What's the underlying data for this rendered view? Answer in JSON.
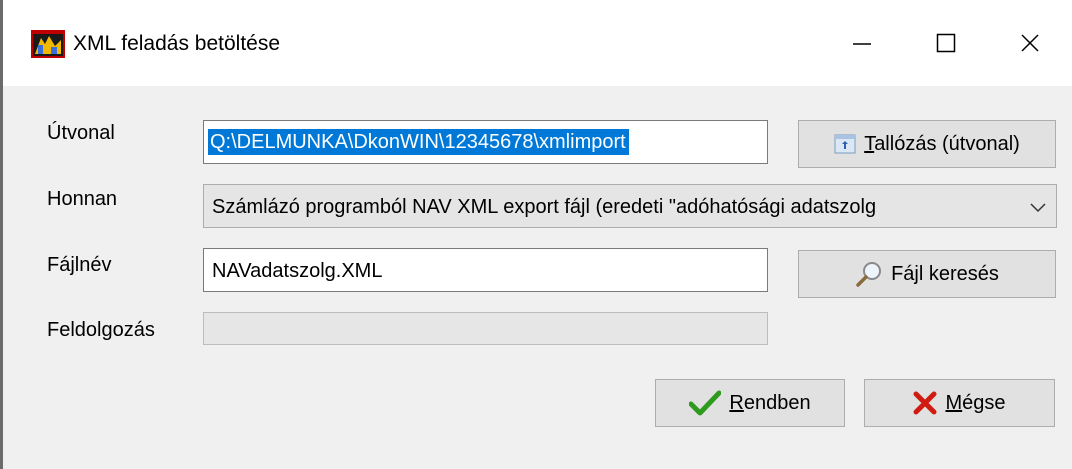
{
  "window": {
    "title": "XML feladás betöltése"
  },
  "form": {
    "path_label": "Útvonal",
    "path_value": "Q:\\DELMUNKA\\DkonWIN\\12345678\\xmlimport",
    "browse_button_mnemonic": "T",
    "browse_button_rest": "allózás (útvonal)",
    "source_label": "Honnan",
    "source_selected": "Számlázó programból NAV XML export fájl (eredeti \"adóhatósági adatszolg",
    "filename_label": "Fájlnév",
    "filename_value": "NAVadatszolg.XML",
    "search_button_label": "Fájl keresés",
    "processing_label": "Feldolgozás",
    "processing_progress": 0
  },
  "buttons": {
    "ok_mnemonic": "R",
    "ok_rest": "endben",
    "cancel_mnemonic": "M",
    "cancel_rest": "égse"
  },
  "colors": {
    "selection": "#0078d7",
    "ok_check": "#2e9b1e",
    "cancel_x": "#d01c10"
  },
  "icons": [
    "app-icon",
    "minimize-icon",
    "maximize-icon",
    "close-icon",
    "folder-browse-icon",
    "chevron-down-icon",
    "magnifier-icon",
    "checkmark-icon",
    "x-icon"
  ]
}
